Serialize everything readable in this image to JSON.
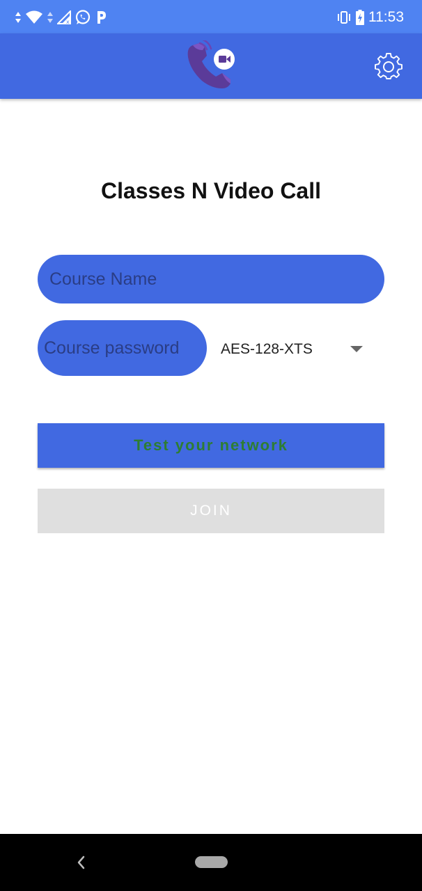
{
  "status_bar": {
    "time": "11:53",
    "left_icons": [
      "data-arrows-icon",
      "wifi-icon",
      "signal-icon",
      "whatsapp-icon",
      "parking-app-icon"
    ],
    "right_icons": [
      "vibrate-icon",
      "battery-charging-icon"
    ]
  },
  "app_bar": {
    "logo_icon": "video-call-phone-icon",
    "settings_icon": "gear-icon"
  },
  "main": {
    "title": "Classes N Video Call",
    "course_name_placeholder": "Course Name",
    "course_password_placeholder": "Course password",
    "encryption_mode": "AES-128-XTS",
    "test_network_label": "Test your network",
    "join_label": "JOIN"
  },
  "colors": {
    "status_bar": "#4f83f2",
    "app_bar": "#4169e1",
    "field_fill": "#4169e1",
    "test_network_text": "#2e7d32",
    "join_disabled_bg": "#dfdfdf",
    "nav_bar": "#000000"
  },
  "nav_bar": {
    "back_icon": "back-chevron-icon",
    "home_icon": "home-pill-icon"
  }
}
